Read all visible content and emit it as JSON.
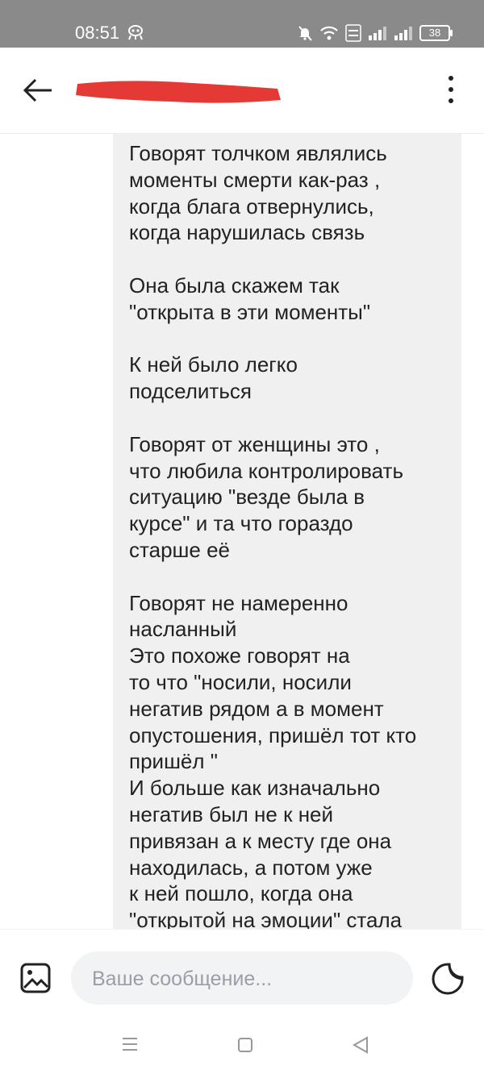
{
  "status_bar": {
    "time": "08:51",
    "battery": "38",
    "icons": [
      "alien-icon",
      "mute-icon",
      "wifi-icon",
      "volte-icon",
      "signal-icon",
      "signal-icon",
      "battery-icon"
    ]
  },
  "header": {
    "back_icon": "arrow-left-icon",
    "more_icon": "more-vertical-icon"
  },
  "chat": {
    "message_text": "Говорят толчком являлись\nмоменты смерти как-раз ,\nкогда блага отвернулись,\nкогда нарушилась связь\n\nОна была скажем так\n\"открыта в эти моменты\"\n\nК ней было легко\nподселиться\n\nГоворят от женщины это ,\nчто любила контролировать\nситуацию \"везде была в\nкурсе\" и та что гораздо\nстарше её\n\nГоворят не намеренно\nнасланный\nЭто похоже говорят на\nто что \"носили, носили\nнегатив рядом а в момент\nопустошения, пришёл тот кто\nпришёл \"\nИ больше как изначально\nнегатив был не к ней\nпривязан а к месту где она\nнаходилась, а потом уже\nк ней пошло, когда она\n\"открытой на эмоции\" стала"
  },
  "composer": {
    "placeholder": "Ваше сообщение...",
    "attach_icon": "image-icon",
    "sticker_icon": "sticker-icon"
  },
  "colors": {
    "status_bar_bg": "#8a8a8a",
    "bubble_bg": "#f0f0f0",
    "redaction": "#e53935",
    "input_bg": "#f2f3f5"
  }
}
